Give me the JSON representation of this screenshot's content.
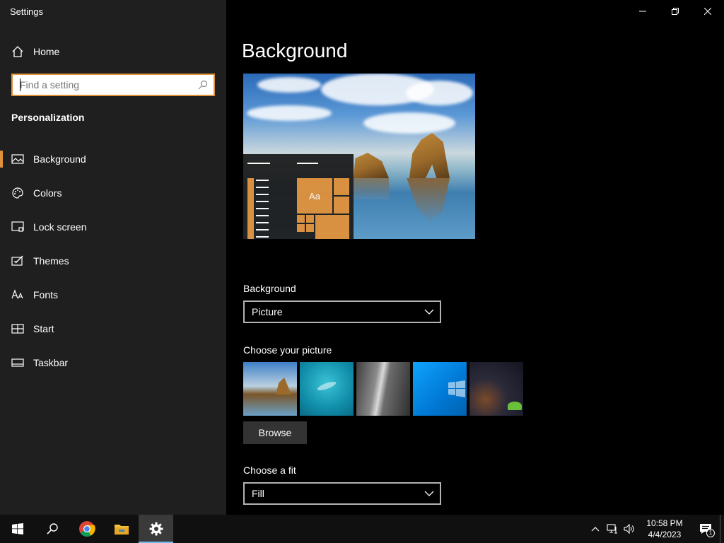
{
  "window": {
    "title": "Settings",
    "controls": {
      "minimize_icon": "minimize-icon",
      "restore_icon": "restore-icon",
      "close_icon": "close-icon"
    }
  },
  "sidebar": {
    "home_label": "Home",
    "search": {
      "placeholder": "Find a setting",
      "value": ""
    },
    "section_title": "Personalization",
    "items": [
      {
        "label": "Background",
        "icon": "picture-icon",
        "active": true
      },
      {
        "label": "Colors",
        "icon": "palette-icon",
        "active": false
      },
      {
        "label": "Lock screen",
        "icon": "lock-screen-icon",
        "active": false
      },
      {
        "label": "Themes",
        "icon": "themes-icon",
        "active": false
      },
      {
        "label": "Fonts",
        "icon": "fonts-icon",
        "active": false
      },
      {
        "label": "Start",
        "icon": "start-icon",
        "active": false
      },
      {
        "label": "Taskbar",
        "icon": "taskbar-icon",
        "active": false
      }
    ]
  },
  "main": {
    "page_title": "Background",
    "preview": {
      "tile_text": "Aa"
    },
    "background_field": {
      "label": "Background",
      "value": "Picture"
    },
    "picture_section": {
      "label": "Choose your picture",
      "thumbnails": [
        "beach-rock-wallpaper",
        "underwater-wallpaper",
        "waterfall-wallpaper",
        "windows-blue-wallpaper",
        "night-sky-tent-wallpaper"
      ],
      "browse_label": "Browse"
    },
    "fit_field": {
      "label": "Choose a fit",
      "value": "Fill"
    }
  },
  "taskbar": {
    "apps": [
      "start-icon",
      "search-icon",
      "chrome-icon",
      "file-explorer-icon",
      "settings-icon"
    ],
    "active_app": "settings-icon",
    "clock": {
      "time": "10:58 PM",
      "date": "4/4/2023"
    },
    "notification_count": "1"
  },
  "colors": {
    "accent": "#e0913b",
    "sidebar_bg": "#1f1f1f",
    "main_bg": "#000000",
    "taskbar_bg": "#101010"
  }
}
